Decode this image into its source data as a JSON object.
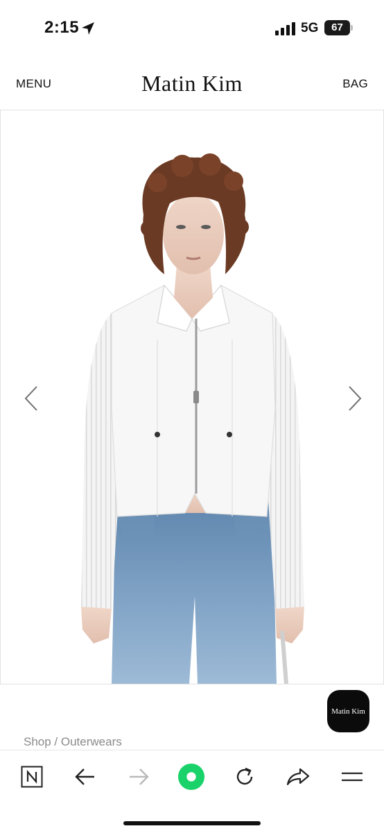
{
  "status_bar": {
    "time": "2:15",
    "network": "5G",
    "battery_level": "67",
    "battery_fraction": 0.67,
    "icons": [
      "location-arrow-icon",
      "cellular-signal-icon",
      "battery-icon"
    ]
  },
  "header": {
    "menu_label": "MENU",
    "brand": "Matin Kim",
    "bag_label": "BAG"
  },
  "gallery": {
    "image_alt": "Model wearing white zip-up shirt jacket with sheer ribbed sleeves and light blue denim jeans",
    "prev_icon": "chevron-left-icon",
    "next_icon": "chevron-right-icon"
  },
  "floating_logo": "Matin  Kim",
  "breadcrumb": "Shop / Outerwears",
  "browser_toolbar": {
    "buttons": [
      "naver-n-icon",
      "back-arrow-icon",
      "forward-arrow-icon",
      "green-home-icon",
      "reload-icon",
      "share-icon",
      "menu-lines-icon"
    ],
    "accent_color": "#19d36a"
  }
}
